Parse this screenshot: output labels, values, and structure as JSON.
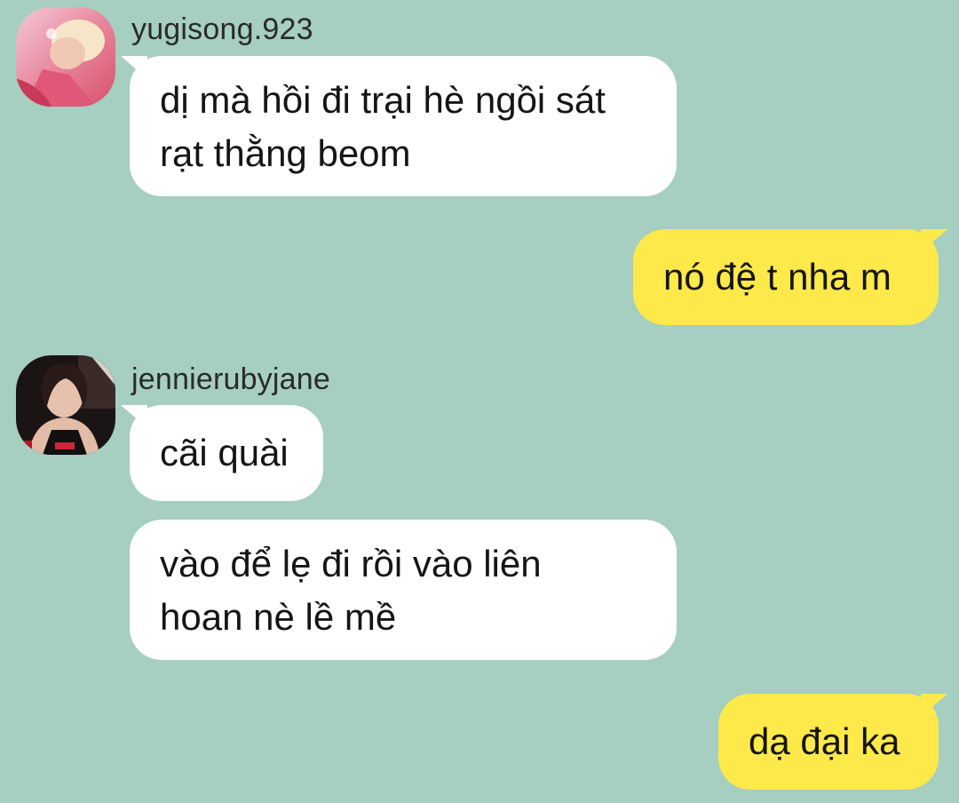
{
  "theme": {
    "background": "#a6cec1",
    "incoming_bubble": "#ffffff",
    "outgoing_bubble": "#fee94a"
  },
  "messages": [
    {
      "sender": "yugisong.923",
      "avatar_icon": "profile-photo-icon",
      "text_lines": [
        "dị mà hồi đi trại hè ngồi sát",
        "rạt thằng beom"
      ]
    },
    {
      "sender": "me",
      "text_lines": [
        "nó đệ t nha m"
      ]
    },
    {
      "sender": "jennierubyjane",
      "avatar_icon": "profile-photo-icon",
      "text_lines": [
        "cãi quài"
      ]
    },
    {
      "sender": "jennierubyjane",
      "text_lines": [
        "vào để lẹ đi rồi vào liên",
        "hoan nè lề mề"
      ]
    },
    {
      "sender": "me",
      "text_lines": [
        "dạ đại ka"
      ]
    }
  ]
}
